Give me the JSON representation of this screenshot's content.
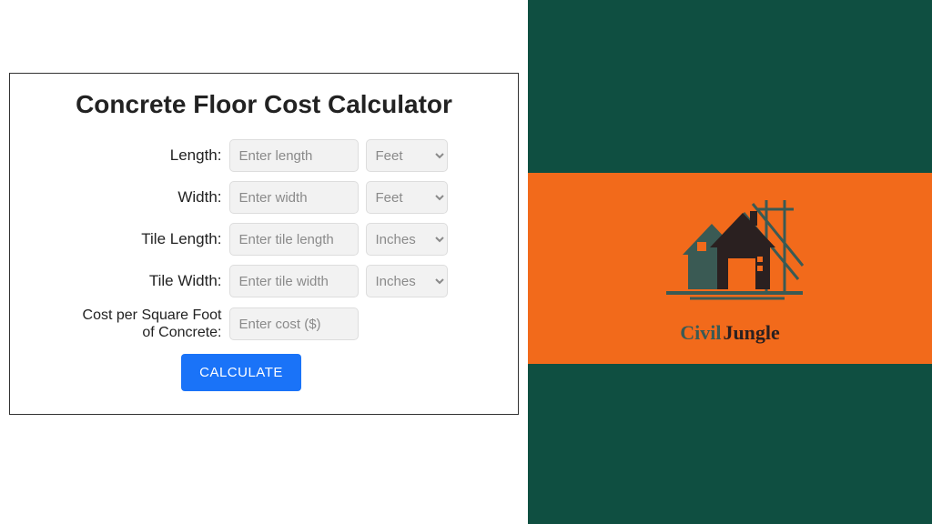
{
  "title": "Concrete Floor Cost Calculator",
  "fields": {
    "length": {
      "label": "Length:",
      "placeholder": "Enter length",
      "unit": "Feet"
    },
    "width": {
      "label": "Width:",
      "placeholder": "Enter width",
      "unit": "Feet"
    },
    "tileLength": {
      "label": "Tile Length:",
      "placeholder": "Enter tile length",
      "unit": "Inches"
    },
    "tileWidth": {
      "label": "Tile Width:",
      "placeholder": "Enter tile width",
      "unit": "Inches"
    },
    "cost": {
      "label": "Cost per Square Foot of Concrete:",
      "placeholder": "Enter cost ($)"
    }
  },
  "button": "CALCULATE",
  "brand": {
    "civil": "Civil",
    "jungle": "Jungle"
  }
}
